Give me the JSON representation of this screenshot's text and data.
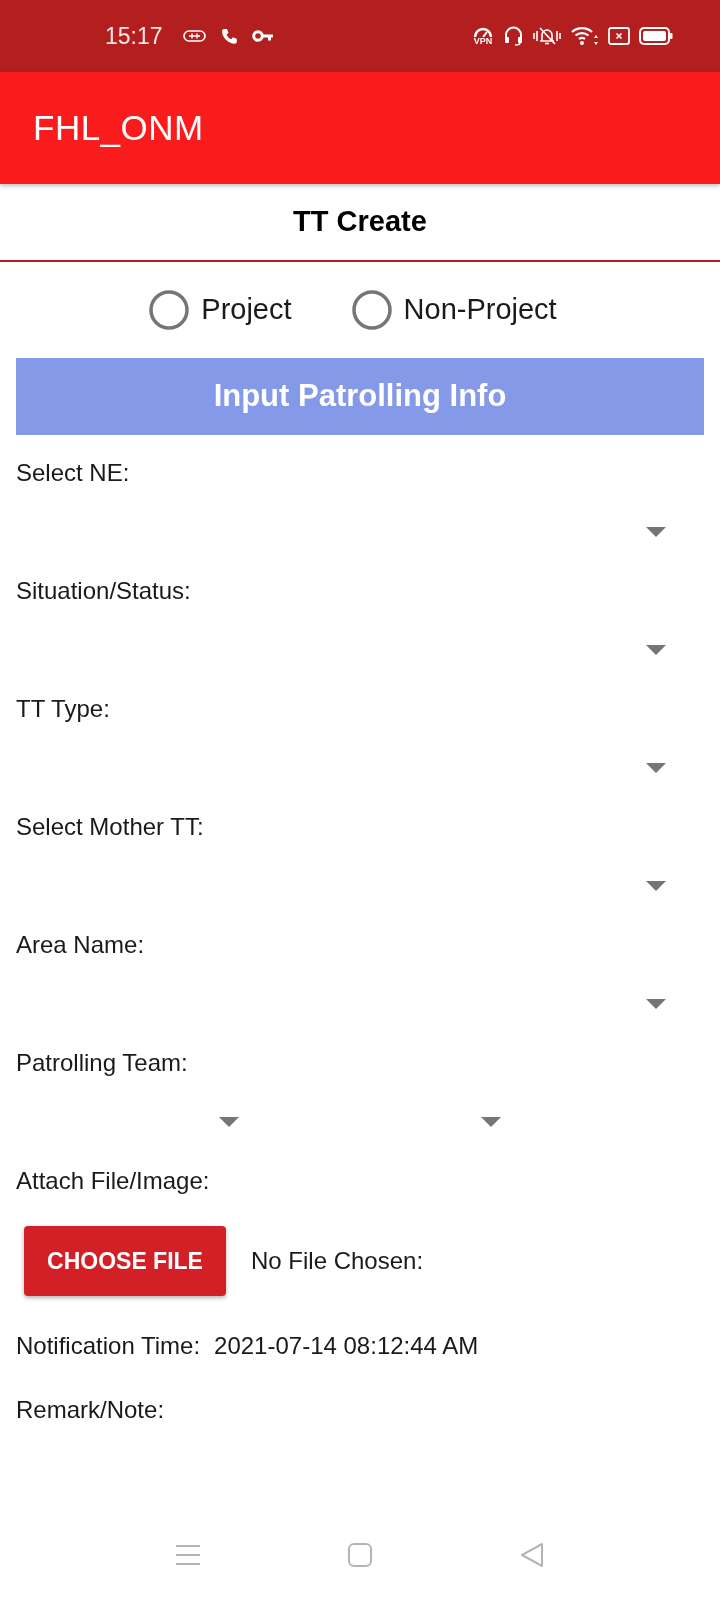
{
  "status_bar": {
    "time": "15:17",
    "vpn_label": "VPN"
  },
  "app_bar": {
    "title": "FHL_ONM"
  },
  "page_title": "TT Create",
  "project_type": [
    {
      "label": "Project",
      "selected": false
    },
    {
      "label": "Non-Project",
      "selected": false
    }
  ],
  "section_header": "Input Patrolling Info",
  "fields": [
    {
      "label": "Select NE:",
      "kind": "dropdown"
    },
    {
      "label": "Situation/Status:",
      "kind": "dropdown"
    },
    {
      "label": "TT Type:",
      "kind": "dropdown"
    },
    {
      "label": "Select Mother TT:",
      "kind": "dropdown"
    },
    {
      "label": "Area Name:",
      "kind": "dropdown"
    },
    {
      "label": "Patrolling Team:",
      "kind": "dropdown_pair"
    }
  ],
  "attachment": {
    "label": "Attach File/Image:",
    "button": "CHOOSE FILE",
    "file_status": "No File Chosen:"
  },
  "notification_time": {
    "label": "Notification Time:",
    "value": "2021-07-14 08:12:44 AM"
  },
  "remark": {
    "label": "Remark/Note:"
  }
}
